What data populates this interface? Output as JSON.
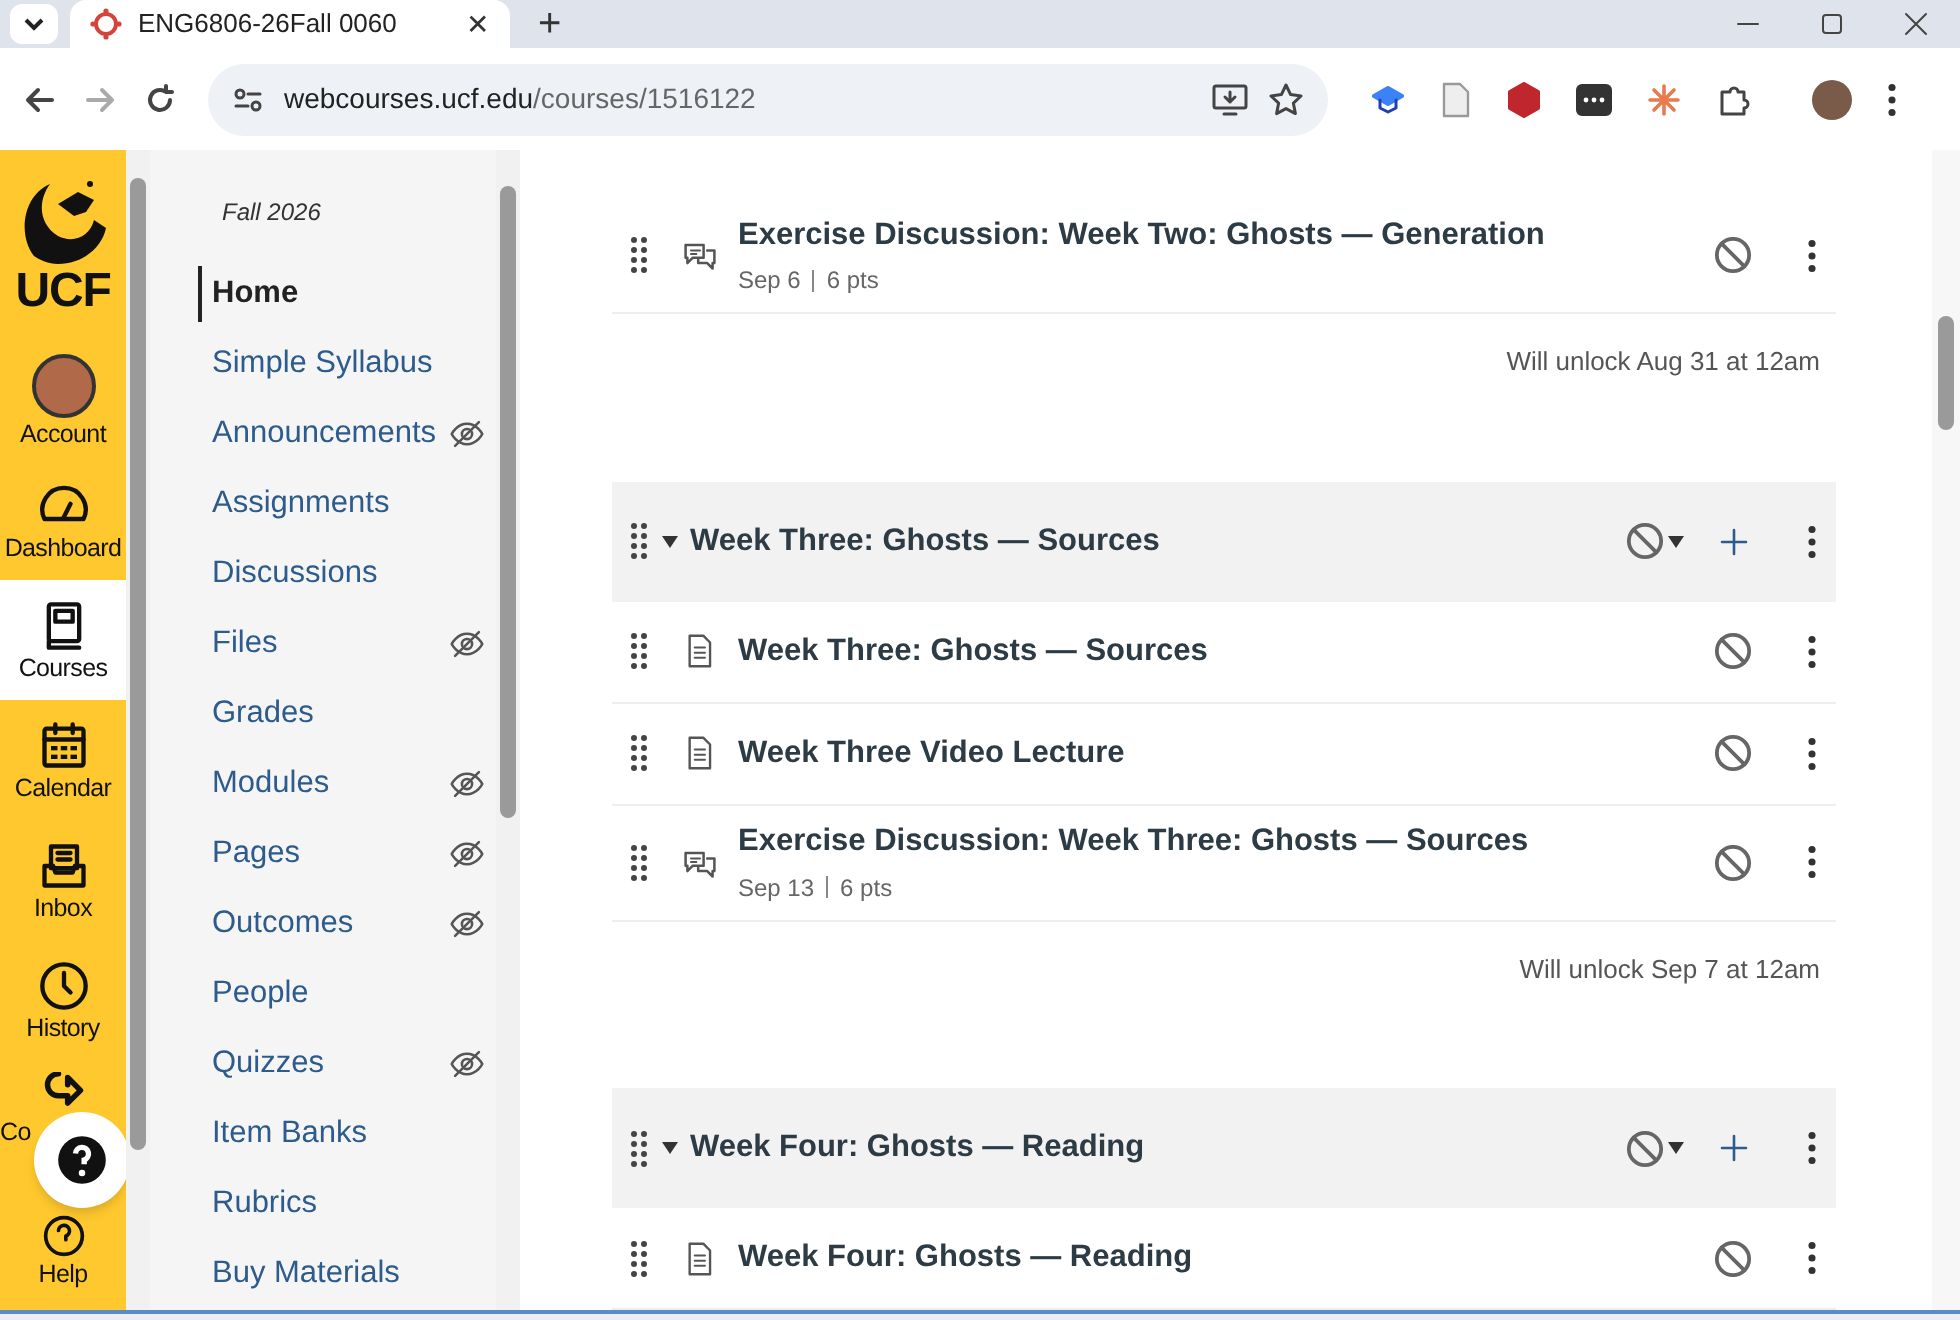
{
  "browser": {
    "tab_title": "ENG6806-26Fall 0060",
    "url_host": "webcourses.ucf.edu",
    "url_path": "/courses/1516122",
    "tab_close": "✕",
    "new_tab": "+"
  },
  "global_nav": {
    "logo": "UCF",
    "items": [
      {
        "kind": "avatar",
        "label": "Account",
        "selected": false
      },
      {
        "kind": "dashboard",
        "label": "Dashboard",
        "selected": false
      },
      {
        "kind": "courses",
        "label": "Courses",
        "selected": true
      },
      {
        "kind": "calendar",
        "label": "Calendar",
        "selected": false
      },
      {
        "kind": "inbox",
        "label": "Inbox",
        "selected": false
      },
      {
        "kind": "history",
        "label": "History",
        "selected": false
      },
      {
        "kind": "commons",
        "label": "Co",
        "selected": false
      },
      {
        "kind": "help",
        "label": "Help",
        "selected": false
      }
    ]
  },
  "course_nav": {
    "term": "Fall 2026",
    "items": [
      {
        "label": "Home",
        "selected": true,
        "hidden": false
      },
      {
        "label": "Simple Syllabus",
        "selected": false,
        "hidden": false
      },
      {
        "label": "Announcements",
        "selected": false,
        "hidden": true
      },
      {
        "label": "Assignments",
        "selected": false,
        "hidden": false
      },
      {
        "label": "Discussions",
        "selected": false,
        "hidden": false
      },
      {
        "label": "Files",
        "selected": false,
        "hidden": true
      },
      {
        "label": "Grades",
        "selected": false,
        "hidden": false
      },
      {
        "label": "Modules",
        "selected": false,
        "hidden": true
      },
      {
        "label": "Pages",
        "selected": false,
        "hidden": true
      },
      {
        "label": "Outcomes",
        "selected": false,
        "hidden": true
      },
      {
        "label": "People",
        "selected": false,
        "hidden": false
      },
      {
        "label": "Quizzes",
        "selected": false,
        "hidden": true
      },
      {
        "label": "Item Banks",
        "selected": false,
        "hidden": false
      },
      {
        "label": "Rubrics",
        "selected": false,
        "hidden": false
      },
      {
        "label": "Buy Materials",
        "selected": false,
        "hidden": false
      }
    ]
  },
  "modules": [
    {
      "items": [
        {
          "kind": "discussion",
          "title": "Exercise Discussion: Week Two: Ghosts — Generation",
          "date": "Sep 6",
          "points": "6 pts"
        }
      ],
      "unlock": "Will unlock Aug 31 at 12am"
    },
    {
      "title": "Week Three: Ghosts — Sources",
      "expanded": true,
      "items": [
        {
          "kind": "page",
          "title": "Week Three: Ghosts — Sources"
        },
        {
          "kind": "page",
          "title": "Week Three Video Lecture"
        },
        {
          "kind": "discussion",
          "title": "Exercise Discussion: Week Three: Ghosts — Sources",
          "date": "Sep 13",
          "points": "6 pts"
        }
      ],
      "unlock": "Will unlock Sep 7 at 12am"
    },
    {
      "title": "Week Four: Ghosts — Reading",
      "expanded": true,
      "items": [
        {
          "kind": "page",
          "title": "Week Four: Ghosts — Reading"
        }
      ]
    }
  ]
}
